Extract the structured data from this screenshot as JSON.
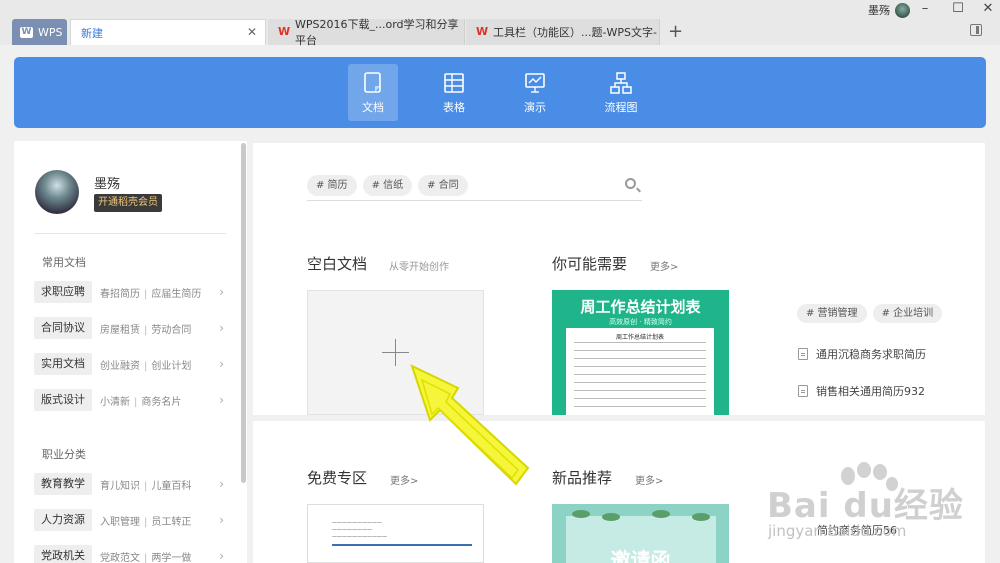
{
  "titlebar": {
    "wps_tab": "WPS",
    "active_tab": "新建",
    "tabs": [
      {
        "label": "WPS2016下载_...ord学习和分享平台"
      },
      {
        "label": "工具栏（功能区）...题-WPS文字-"
      }
    ],
    "user_name": "墨殇"
  },
  "categories": [
    {
      "label": "文档",
      "icon": "document-icon",
      "active": true
    },
    {
      "label": "表格",
      "icon": "table-icon",
      "active": false
    },
    {
      "label": "演示",
      "icon": "presentation-icon",
      "active": false
    },
    {
      "label": "流程图",
      "icon": "flowchart-icon",
      "active": false
    }
  ],
  "sidebar": {
    "user_name": "墨殇",
    "vip_label": "开通稻壳会员",
    "section_common": "常用文档",
    "common": [
      {
        "tag": "求职应聘",
        "sub1": "春招简历",
        "sub2": "应届生简历"
      },
      {
        "tag": "合同协议",
        "sub1": "房屋租赁",
        "sub2": "劳动合同"
      },
      {
        "tag": "实用文档",
        "sub1": "创业融资",
        "sub2": "创业计划"
      },
      {
        "tag": "版式设计",
        "sub1": "小清新",
        "sub2": "商务名片"
      }
    ],
    "section_career": "职业分类",
    "career": [
      {
        "tag": "教育教学",
        "sub1": "育儿知识",
        "sub2": "儿童百科"
      },
      {
        "tag": "人力资源",
        "sub1": "入职管理",
        "sub2": "员工转正"
      },
      {
        "tag": "党政机关",
        "sub1": "党政范文",
        "sub2": "两学一做"
      }
    ]
  },
  "search": {
    "tags": [
      "# 简历",
      "# 信纸",
      "# 合同"
    ]
  },
  "blank": {
    "title": "空白文档",
    "subtitle": "从零开始创作"
  },
  "recommend": {
    "title": "你可能需要",
    "more": "更多>",
    "template_title": "周工作总结计划表",
    "template_subtitle": "高效原创 · 精致简约",
    "paper_heading": "周工作总结计划表",
    "tags": [
      "# 营销管理",
      "# 企业培训"
    ],
    "links": [
      "通用沉稳商务求职简历",
      "销售相关通用简历932"
    ]
  },
  "free": {
    "title": "免费专区",
    "more": "更多>"
  },
  "new": {
    "title": "新品推荐",
    "more": "更多>",
    "card_text": "邀请函"
  },
  "peek_link": "简约商务简历56",
  "watermark": {
    "brand": "Bai  du经验",
    "url": "jingyan.baidu.com"
  }
}
